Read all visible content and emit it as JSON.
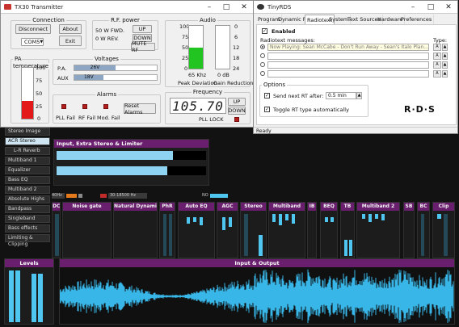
{
  "tx": {
    "title": "TX30 Transmitter",
    "connection": {
      "title": "Connection",
      "disconnect": "Disconnect",
      "about": "About",
      "exit": "Exit",
      "port": "COM5"
    },
    "rfpower": {
      "title": "R.F. power",
      "fwd": "50 W FWD.",
      "rev": "0 W REV.",
      "up": "UP",
      "down": "DOWN",
      "mute": "MUTE RF"
    },
    "audio": {
      "title": "Audio",
      "scale_left": [
        "100",
        "75",
        "50",
        "25",
        "0"
      ],
      "scale_right": [
        "0",
        "6",
        "12",
        "18",
        "24"
      ],
      "freq": "65 Khz",
      "db": "0 dB",
      "peak_label": "Peak Deviation",
      "gain_label": "Gain Reduction",
      "peak_level": 0.5
    },
    "pa_temp": {
      "title": "PA temperature",
      "scale": [
        "100",
        "75",
        "50",
        "25",
        "0"
      ],
      "level": 0.35
    },
    "voltages": {
      "title": "Voltages",
      "pa_label": "P.A.",
      "pa_value": "26V",
      "aux_label": "AUX",
      "aux_value": "18V"
    },
    "alarms": {
      "title": "Alarms",
      "pll": "PLL Fail",
      "rf": "RF Fail",
      "mod": "Mod. Fail",
      "reset": "Reset Alarms"
    },
    "frequency": {
      "title": "Frequency",
      "value": "105.70",
      "up": "UP",
      "down": "DOWN",
      "pll": "PLL LOCK"
    }
  },
  "rds": {
    "title": "TinyRDS",
    "tabs": [
      "Program",
      "Dynamic PS",
      "Radiotext",
      "System",
      "Text Sources",
      "Hardware",
      "Preferences"
    ],
    "enabled_label": "Enabled",
    "messages_label": "Radiotext messages:",
    "type_label": "Type:",
    "messages": [
      "Now Playing: Sean McCabe - Don't Run Away - Sean's Italo Plan...",
      "",
      "",
      "",
      ""
    ],
    "type_value": "A",
    "options_title": "Options",
    "send_next_label": "Send next RT after:",
    "send_next_value": "0.5 min",
    "toggle_label": "Toggle RT type automatically",
    "logo": "R·D·S",
    "status": "Ready"
  },
  "proc": {
    "sidebar": [
      "Stereo Image",
      "ACR Stereo",
      "L-R Reverb",
      "Multiband 1",
      "Equalizer",
      "Bass EQ",
      "Multiband 2",
      "Absolute Highs",
      "Bandpass",
      "Singleband",
      "Bass effects",
      "Limiting & Clipping"
    ],
    "active_index": 1,
    "panel_title": "Input, Extra Stereo & Limiter",
    "strip": {
      "left": "40Hz",
      "mid": "30-18500 Hz",
      "right": "NO"
    },
    "modules": [
      "DC",
      "Noise gate",
      "Natural Dynamics",
      "PhR",
      "Auto EQ",
      "AGC",
      "Stereo",
      "Multiband",
      "IB",
      "BEQ",
      "TB",
      "Multiband 2",
      "SB",
      "BC",
      "Clip"
    ],
    "levels_title": "Levels",
    "io_title": "Input & Output"
  }
}
